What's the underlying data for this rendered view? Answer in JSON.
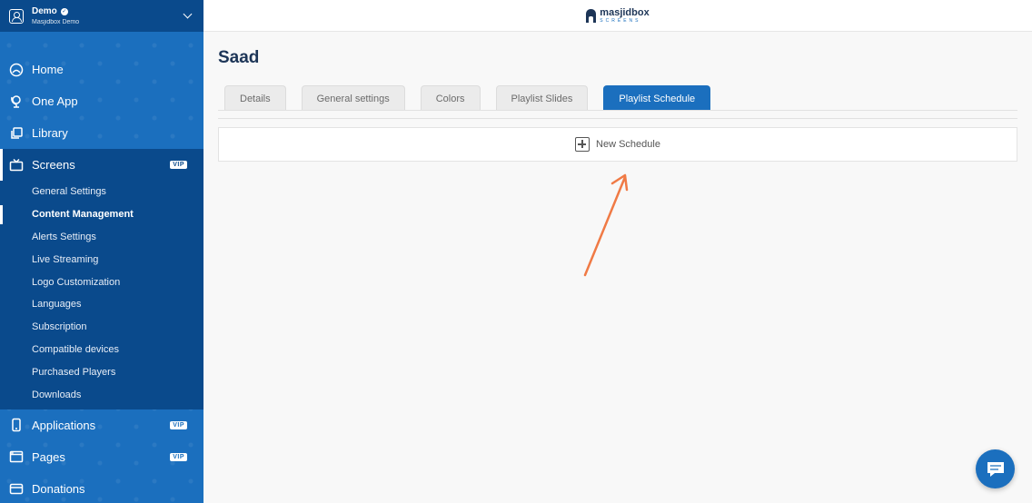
{
  "account": {
    "name": "Demo",
    "subtitle": "Masjidbox Demo"
  },
  "brand": {
    "name": "masjidbox",
    "sub": "SCREENS"
  },
  "nav": [
    {
      "label": "Home",
      "icon": "home-icon"
    },
    {
      "label": "One App",
      "icon": "globe-stand-icon"
    },
    {
      "label": "Library",
      "icon": "library-icon"
    },
    {
      "label": "Screens",
      "icon": "tv-icon",
      "vip": "VIP",
      "active": true
    },
    {
      "label": "Applications",
      "icon": "phone-icon",
      "vip": "VIP"
    },
    {
      "label": "Pages",
      "icon": "browser-icon",
      "vip": "VIP"
    },
    {
      "label": "Donations",
      "icon": "wallet-icon"
    }
  ],
  "screens_sub": [
    "General Settings",
    "Content Management",
    "Alerts Settings",
    "Live Streaming",
    "Logo Customization",
    "Languages",
    "Subscription",
    "Compatible devices",
    "Purchased Players",
    "Downloads"
  ],
  "page": {
    "title": "Saad"
  },
  "tabs": [
    "Details",
    "General settings",
    "Colors",
    "Playlist Slides",
    "Playlist Schedule"
  ],
  "active_tab": "Playlist Schedule",
  "new_schedule_label": "New Schedule",
  "colors": {
    "sidebar": "#1b6fbe",
    "sidebar_dark": "#0a4a8c",
    "arrow": "#f07a45"
  }
}
